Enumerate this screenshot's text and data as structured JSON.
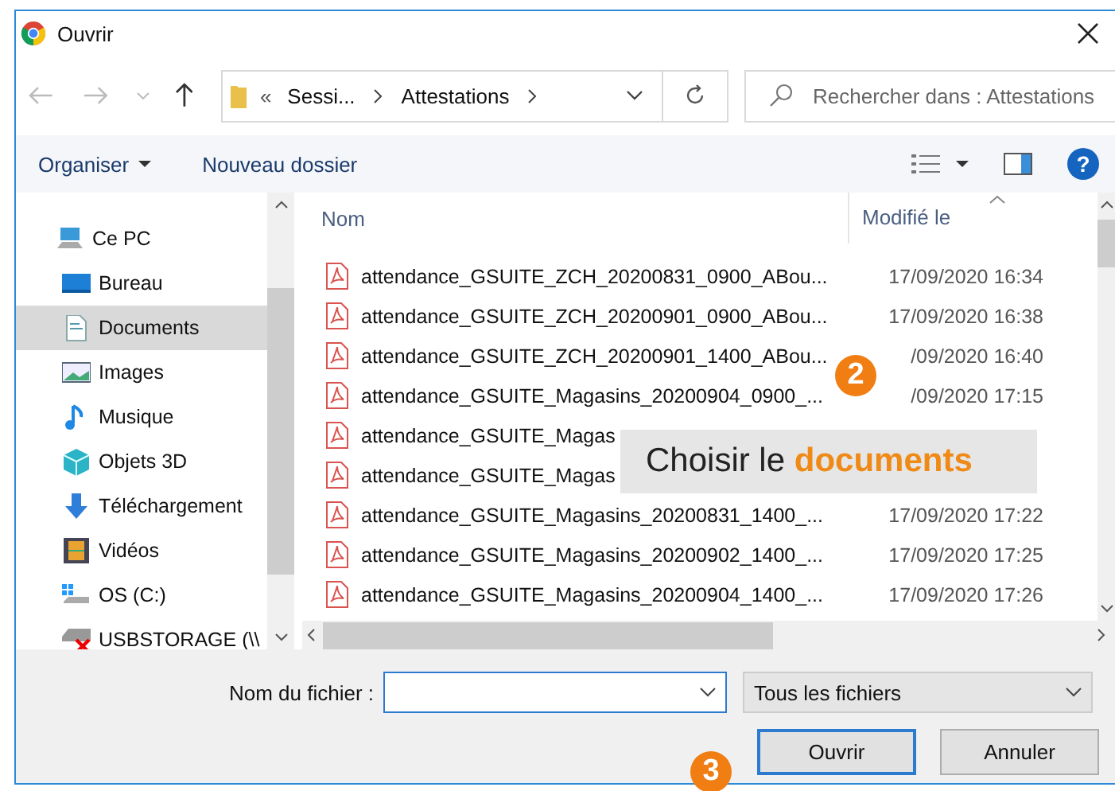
{
  "window": {
    "title": "Ouvrir"
  },
  "address_bar": {
    "overflow": "«",
    "segments": [
      "Sessi...",
      "Attestations"
    ]
  },
  "search": {
    "placeholder": "Rechercher dans : Attestations"
  },
  "toolbar": {
    "organize": "Organiser",
    "new_folder": "Nouveau dossier",
    "help": "?"
  },
  "sidebar": {
    "items": [
      {
        "label": "Ce PC",
        "kind": "pc",
        "selected": false,
        "children": [
          {
            "label": "Bureau",
            "kind": "desktop",
            "selected": false
          },
          {
            "label": "Documents",
            "kind": "documents",
            "selected": true
          },
          {
            "label": "Images",
            "kind": "pictures",
            "selected": false
          },
          {
            "label": "Musique",
            "kind": "music",
            "selected": false
          },
          {
            "label": "Objets 3D",
            "kind": "objects3d",
            "selected": false
          },
          {
            "label": "Téléchargement",
            "kind": "downloads",
            "selected": false
          },
          {
            "label": "Vidéos",
            "kind": "videos",
            "selected": false
          },
          {
            "label": "OS (C:)",
            "kind": "drive",
            "selected": false
          },
          {
            "label": "USBSTORAGE (\\\\",
            "kind": "netdrive",
            "selected": false
          }
        ]
      }
    ]
  },
  "file_list": {
    "columns": [
      "Nom",
      "Modifié le"
    ],
    "rows": [
      {
        "name": "attendance_GSUITE_ZCH_20200831_0900_ABou...",
        "modified": "17/09/2020 16:34"
      },
      {
        "name": "attendance_GSUITE_ZCH_20200901_0900_ABou...",
        "modified": "17/09/2020 16:38"
      },
      {
        "name": "attendance_GSUITE_ZCH_20200901_1400_ABou...",
        "modified": "/09/2020 16:40"
      },
      {
        "name": "attendance_GSUITE_Magasins_20200904_0900_...",
        "modified": "/09/2020 17:15"
      },
      {
        "name": "attendance_GSUITE_Magas"
      },
      {
        "name": "attendance_GSUITE_Magas"
      },
      {
        "name": "attendance_GSUITE_Magasins_20200831_1400_...",
        "modified": "17/09/2020 17:22"
      },
      {
        "name": "attendance_GSUITE_Magasins_20200902_1400_...",
        "modified": "17/09/2020 17:25"
      },
      {
        "name": "attendance_GSUITE_Magasins_20200904_1400_...",
        "modified": "17/09/2020 17:26"
      }
    ]
  },
  "tooltip": {
    "text": "Choisir le  **documents**"
  },
  "callouts": [
    {
      "number": "2"
    },
    {
      "number": "3"
    }
  ],
  "footer": {
    "filename_label": "Nom du fichier :",
    "filter": "Tous les fichiers",
    "buttons": [
      {
        "label": "Ouvrir",
        "default": true
      },
      {
        "label": "Annuler",
        "default": false
      }
    ]
  }
}
